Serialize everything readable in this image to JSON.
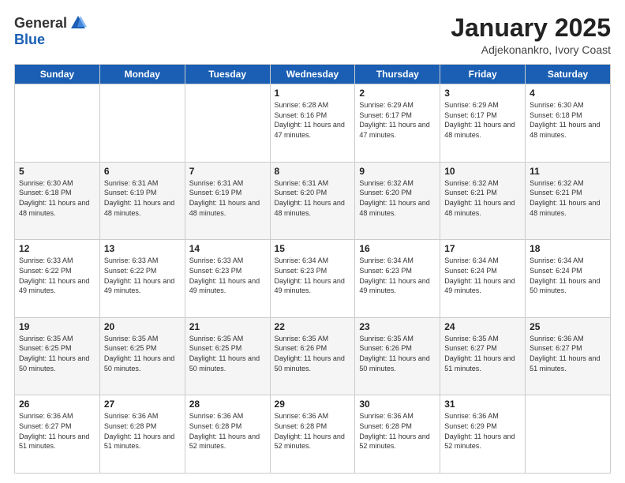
{
  "logo": {
    "general": "General",
    "blue": "Blue"
  },
  "title": {
    "month_year": "January 2025",
    "location": "Adjekonankro, Ivory Coast"
  },
  "days_of_week": [
    "Sunday",
    "Monday",
    "Tuesday",
    "Wednesday",
    "Thursday",
    "Friday",
    "Saturday"
  ],
  "weeks": [
    [
      {
        "day": "",
        "info": ""
      },
      {
        "day": "",
        "info": ""
      },
      {
        "day": "",
        "info": ""
      },
      {
        "day": "1",
        "info": "Sunrise: 6:28 AM\nSunset: 6:16 PM\nDaylight: 11 hours and 47 minutes."
      },
      {
        "day": "2",
        "info": "Sunrise: 6:29 AM\nSunset: 6:17 PM\nDaylight: 11 hours and 47 minutes."
      },
      {
        "day": "3",
        "info": "Sunrise: 6:29 AM\nSunset: 6:17 PM\nDaylight: 11 hours and 48 minutes."
      },
      {
        "day": "4",
        "info": "Sunrise: 6:30 AM\nSunset: 6:18 PM\nDaylight: 11 hours and 48 minutes."
      }
    ],
    [
      {
        "day": "5",
        "info": "Sunrise: 6:30 AM\nSunset: 6:18 PM\nDaylight: 11 hours and 48 minutes."
      },
      {
        "day": "6",
        "info": "Sunrise: 6:31 AM\nSunset: 6:19 PM\nDaylight: 11 hours and 48 minutes."
      },
      {
        "day": "7",
        "info": "Sunrise: 6:31 AM\nSunset: 6:19 PM\nDaylight: 11 hours and 48 minutes."
      },
      {
        "day": "8",
        "info": "Sunrise: 6:31 AM\nSunset: 6:20 PM\nDaylight: 11 hours and 48 minutes."
      },
      {
        "day": "9",
        "info": "Sunrise: 6:32 AM\nSunset: 6:20 PM\nDaylight: 11 hours and 48 minutes."
      },
      {
        "day": "10",
        "info": "Sunrise: 6:32 AM\nSunset: 6:21 PM\nDaylight: 11 hours and 48 minutes."
      },
      {
        "day": "11",
        "info": "Sunrise: 6:32 AM\nSunset: 6:21 PM\nDaylight: 11 hours and 48 minutes."
      }
    ],
    [
      {
        "day": "12",
        "info": "Sunrise: 6:33 AM\nSunset: 6:22 PM\nDaylight: 11 hours and 49 minutes."
      },
      {
        "day": "13",
        "info": "Sunrise: 6:33 AM\nSunset: 6:22 PM\nDaylight: 11 hours and 49 minutes."
      },
      {
        "day": "14",
        "info": "Sunrise: 6:33 AM\nSunset: 6:23 PM\nDaylight: 11 hours and 49 minutes."
      },
      {
        "day": "15",
        "info": "Sunrise: 6:34 AM\nSunset: 6:23 PM\nDaylight: 11 hours and 49 minutes."
      },
      {
        "day": "16",
        "info": "Sunrise: 6:34 AM\nSunset: 6:23 PM\nDaylight: 11 hours and 49 minutes."
      },
      {
        "day": "17",
        "info": "Sunrise: 6:34 AM\nSunset: 6:24 PM\nDaylight: 11 hours and 49 minutes."
      },
      {
        "day": "18",
        "info": "Sunrise: 6:34 AM\nSunset: 6:24 PM\nDaylight: 11 hours and 50 minutes."
      }
    ],
    [
      {
        "day": "19",
        "info": "Sunrise: 6:35 AM\nSunset: 6:25 PM\nDaylight: 11 hours and 50 minutes."
      },
      {
        "day": "20",
        "info": "Sunrise: 6:35 AM\nSunset: 6:25 PM\nDaylight: 11 hours and 50 minutes."
      },
      {
        "day": "21",
        "info": "Sunrise: 6:35 AM\nSunset: 6:25 PM\nDaylight: 11 hours and 50 minutes."
      },
      {
        "day": "22",
        "info": "Sunrise: 6:35 AM\nSunset: 6:26 PM\nDaylight: 11 hours and 50 minutes."
      },
      {
        "day": "23",
        "info": "Sunrise: 6:35 AM\nSunset: 6:26 PM\nDaylight: 11 hours and 50 minutes."
      },
      {
        "day": "24",
        "info": "Sunrise: 6:35 AM\nSunset: 6:27 PM\nDaylight: 11 hours and 51 minutes."
      },
      {
        "day": "25",
        "info": "Sunrise: 6:36 AM\nSunset: 6:27 PM\nDaylight: 11 hours and 51 minutes."
      }
    ],
    [
      {
        "day": "26",
        "info": "Sunrise: 6:36 AM\nSunset: 6:27 PM\nDaylight: 11 hours and 51 minutes."
      },
      {
        "day": "27",
        "info": "Sunrise: 6:36 AM\nSunset: 6:28 PM\nDaylight: 11 hours and 51 minutes."
      },
      {
        "day": "28",
        "info": "Sunrise: 6:36 AM\nSunset: 6:28 PM\nDaylight: 11 hours and 52 minutes."
      },
      {
        "day": "29",
        "info": "Sunrise: 6:36 AM\nSunset: 6:28 PM\nDaylight: 11 hours and 52 minutes."
      },
      {
        "day": "30",
        "info": "Sunrise: 6:36 AM\nSunset: 6:28 PM\nDaylight: 11 hours and 52 minutes."
      },
      {
        "day": "31",
        "info": "Sunrise: 6:36 AM\nSunset: 6:29 PM\nDaylight: 11 hours and 52 minutes."
      },
      {
        "day": "",
        "info": ""
      }
    ]
  ]
}
